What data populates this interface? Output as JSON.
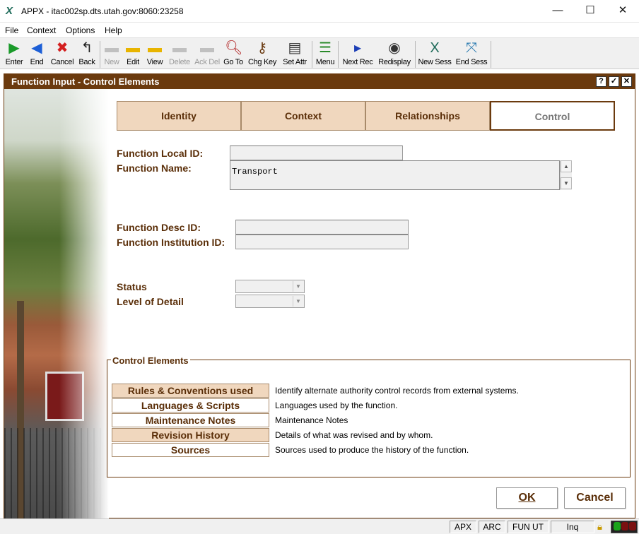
{
  "window": {
    "title": "APPX - itac002sp.dts.utah.gov:8060:23258",
    "app_icon": "appx-x-icon",
    "minimize": "—",
    "maximize": "☐",
    "close": "✕"
  },
  "menu": [
    "File",
    "Context",
    "Options",
    "Help"
  ],
  "toolbar": [
    {
      "label": "Enter",
      "icon": "enter-icon",
      "glyph": "▶",
      "color": "#1a9a2a",
      "enabled": true
    },
    {
      "label": "End",
      "icon": "end-icon",
      "glyph": "◀",
      "color": "#1d5fd6",
      "enabled": true
    },
    {
      "label": "Cancel",
      "icon": "cancel-icon",
      "glyph": "✖",
      "color": "#d42020",
      "enabled": true
    },
    {
      "label": "Back",
      "icon": "back-icon",
      "glyph": "↰",
      "color": "#222222",
      "enabled": true
    },
    {
      "label": "New",
      "icon": "new-icon",
      "glyph": "▬",
      "color": "#888888",
      "enabled": false
    },
    {
      "label": "Edit",
      "icon": "edit-icon",
      "glyph": "▬",
      "color": "#e8b400",
      "enabled": true
    },
    {
      "label": "View",
      "icon": "view-icon",
      "glyph": "▬",
      "color": "#e8b400",
      "enabled": true
    },
    {
      "label": "Delete",
      "icon": "delete-icon",
      "glyph": "▬",
      "color": "#888888",
      "enabled": false
    },
    {
      "label": "Ack Del",
      "icon": "ack-delete-icon",
      "glyph": "▬",
      "color": "#888888",
      "enabled": false
    },
    {
      "label": "Go To",
      "icon": "goto-magnifier-icon",
      "glyph": "🔍︎",
      "color": "#b02020",
      "enabled": true
    },
    {
      "label": "Chg Key",
      "icon": "change-key-icon",
      "glyph": "⚷",
      "color": "#6a3a10",
      "enabled": true
    },
    {
      "label": "Set Attr",
      "icon": "set-attributes-icon",
      "glyph": "▤",
      "color": "#333333",
      "enabled": true
    },
    {
      "label": "Menu",
      "icon": "menu-icon",
      "glyph": "☰",
      "color": "#2a8a2a",
      "enabled": true
    },
    {
      "label": "Next Rec",
      "icon": "next-record-icon",
      "glyph": "▸",
      "color": "#1d3fb6",
      "enabled": true
    },
    {
      "label": "Redisplay",
      "icon": "redisplay-icon",
      "glyph": "◉",
      "color": "#333333",
      "enabled": true
    },
    {
      "label": "New Sess",
      "icon": "new-session-icon",
      "glyph": "X",
      "color": "#1f6b5a",
      "enabled": true
    },
    {
      "label": "End Sess",
      "icon": "end-session-icon",
      "glyph": "⤧",
      "color": "#2a7ab0",
      "enabled": true
    }
  ],
  "dialog": {
    "title": "Function Input - Control Elements",
    "help_btn": "?",
    "ok_btn": "✓",
    "close_btn": "✕"
  },
  "tabs": [
    {
      "label": "Identity",
      "active": false
    },
    {
      "label": "Context",
      "active": false
    },
    {
      "label": "Relationships",
      "active": false
    },
    {
      "label": "Control",
      "active": true
    }
  ],
  "form": {
    "function_local_id": {
      "label": "Function Local ID:",
      "value": ""
    },
    "function_name": {
      "label": "Function Name:",
      "value": "Transport"
    },
    "function_desc_id": {
      "label": "Function Desc ID:",
      "value": ""
    },
    "function_institution_id": {
      "label": "Function Institution ID:",
      "value": ""
    },
    "status": {
      "label": "Status",
      "value": ""
    },
    "level_of_detail": {
      "label": "Level of Detail",
      "value": ""
    }
  },
  "control_elements": {
    "label": "Control Elements",
    "items": [
      {
        "button": "Rules & Conventions used",
        "desc": "Identify alternate authority control records from external systems.",
        "filled": true
      },
      {
        "button": "Languages & Scripts",
        "desc": "Languages used by the function.",
        "filled": false
      },
      {
        "button": "Maintenance Notes",
        "desc": "Maintenance Notes",
        "filled": false
      },
      {
        "button": "Revision History",
        "desc": "Details of what was revised and by whom.",
        "filled": true
      },
      {
        "button": "Sources",
        "desc": "Sources used to produce the history of the function.",
        "filled": false
      }
    ]
  },
  "buttons": {
    "ok": "OK",
    "cancel": "Cancel"
  },
  "statusbar": {
    "cells": [
      "APX",
      "ARC",
      "FUN UT",
      "Inq"
    ],
    "lock_icon": "padlock-icon",
    "indicator_colors": [
      "#1aa31a",
      "#7a1010",
      "#7a1010"
    ]
  }
}
